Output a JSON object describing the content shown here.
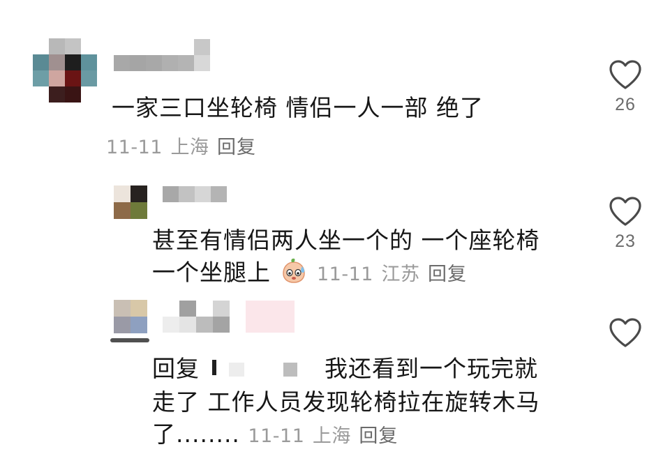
{
  "comments": [
    {
      "text": "一家三口坐轮椅 情侣一人一部 绝了",
      "date": "11-11",
      "location": "上海",
      "reply_label": "回复",
      "likes": "26"
    },
    {
      "text_line1": "甚至有情侣两人坐一个的 一个座轮椅",
      "text_line2": "一个坐腿上",
      "emoji": "sweat-face-emoji",
      "date": "11-11",
      "location": "江苏",
      "reply_label": "回复",
      "likes": "23"
    },
    {
      "reply_prefix": "回复",
      "text_line1": "我还看到一个玩完就",
      "text_line2": "走了 工作人员发现轮椅拉在旋转木马",
      "text_line3": "了........",
      "date": "11-11",
      "location": "上海",
      "reply_label": "回复",
      "likes": ""
    }
  ],
  "colors": {
    "text": "#161616",
    "meta": "#9a9a9a",
    "reply": "#6b6b6b",
    "heart_stroke": "#4a4a4a"
  }
}
